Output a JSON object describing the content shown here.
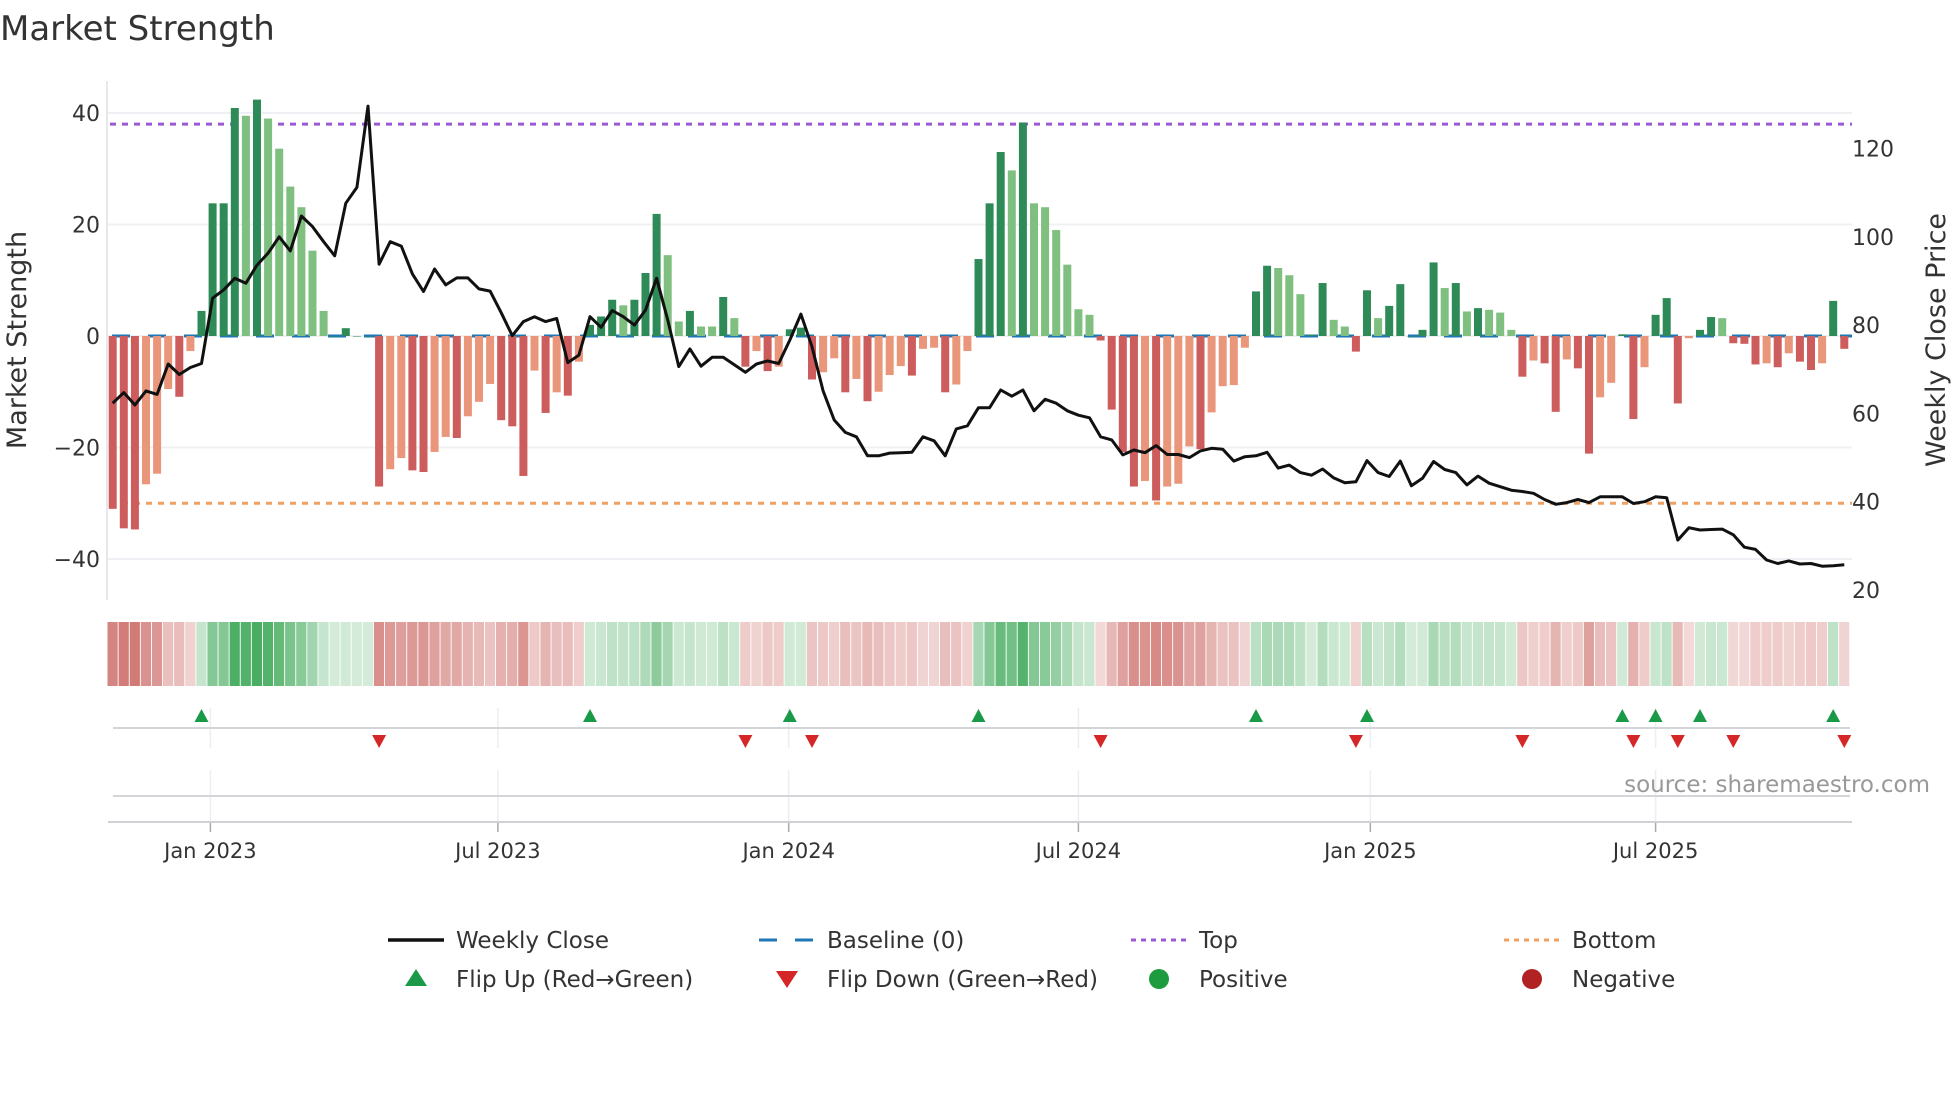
{
  "title": "Market Strength",
  "source": "source: sharemaestro.com",
  "colors": {
    "strong_pos": "#2e8b57",
    "weak_pos": "#7fbf7f",
    "strong_neg": "#cd5c5c",
    "weak_neg": "#e9967a",
    "strip_pos": "#3aa655",
    "strip_neg": "#c65a55",
    "line": "#111111",
    "baseline": "#1f77b4",
    "top": "#9b59d6",
    "bottom": "#f0a060",
    "flip_up": "#1a9a48",
    "flip_down": "#d62728",
    "positive": "#1e9b3e",
    "negative": "#b22222"
  },
  "chart_data": {
    "type": "bar",
    "title": "Market Strength",
    "ylabel": "Market Strength",
    "y2label": "Weekly Close Price",
    "ylim": [
      -45,
      45
    ],
    "y2lim": [
      20,
      129
    ],
    "yticks": [
      40,
      20,
      0,
      -20,
      -40
    ],
    "y2ticks": [
      120,
      100,
      80,
      60,
      40,
      20
    ],
    "top_level": 38,
    "bottom_level": -30,
    "baseline": 0,
    "xticks": [
      {
        "label": "Jan 2023",
        "week": 8.8
      },
      {
        "label": "Jul 2023",
        "week": 34.7
      },
      {
        "label": "Jan 2024",
        "week": 60.9
      },
      {
        "label": "Jul 2024",
        "week": 87.0
      },
      {
        "label": "Jan 2025",
        "week": 113.3
      },
      {
        "label": "Jul 2025",
        "week": 139.0
      }
    ],
    "strength": [
      -31,
      -34.5,
      -34.7,
      -26.6,
      -24.7,
      -9.5,
      -10.9,
      -2.7,
      4.5,
      23.8,
      23.8,
      40.9,
      39.5,
      42.4,
      39,
      33.6,
      26.8,
      23.1,
      15.3,
      4.5,
      0,
      1.4,
      0,
      0,
      -27,
      -23.9,
      -21.9,
      -24.1,
      -24.4,
      -20.8,
      -18.1,
      -18.3,
      -14.4,
      -11.8,
      -8.6,
      -15.1,
      -16.2,
      -25.1,
      -6.2,
      -13.8,
      -10.1,
      -10.7,
      -4.6,
      2,
      3.5,
      6.5,
      5.5,
      6.5,
      11.3,
      21.9,
      14.5,
      2.6,
      4.5,
      1.7,
      1.7,
      7,
      3.2,
      -5.5,
      -2.7,
      -6.3,
      -5.5,
      1.2,
      1.5,
      -7.8,
      -6.5,
      -4,
      -10.1,
      -7.7,
      -11.7,
      -10,
      -7,
      -5.4,
      -7.1,
      -2.3,
      -2.1,
      -10.1,
      -8.7,
      -2.7,
      13.8,
      23.8,
      33,
      29.7,
      38.3,
      23.8,
      23.1,
      19,
      12.8,
      4.8,
      3.8,
      -0.8,
      -13.2,
      -20.8,
      -27,
      -26,
      -29.5,
      -27,
      -26.5,
      -19.8,
      -20.3,
      -13.7,
      -9,
      -8.8,
      -2.1,
      8,
      12.6,
      12.2,
      10.9,
      7.5,
      0.2,
      9.5,
      2.9,
      1.7,
      -2.8,
      8.2,
      3.2,
      5.4,
      9.3,
      0,
      1.1,
      13.2,
      8.6,
      9.5,
      4.4,
      5,
      4.7,
      4.2,
      1.1,
      -7.3,
      -4.4,
      -4.9,
      -13.6,
      -4.2,
      -5.8,
      -21.1,
      -11,
      -8.4,
      0.3,
      -14.9,
      -5.6,
      3.8,
      6.8,
      -12.1,
      -0.4,
      1.1,
      3.4,
      3.2,
      -1.3,
      -1.4,
      -5.1,
      -4.9,
      -5.6,
      -3.1,
      -4.6,
      -6.1,
      -4.9,
      6.3,
      -2.3
    ],
    "strong": [
      1,
      1,
      1,
      0,
      0,
      0,
      1,
      0,
      1,
      1,
      1,
      1,
      0,
      1,
      0,
      0,
      0,
      0,
      0,
      0,
      1,
      1,
      1,
      1,
      1,
      0,
      0,
      1,
      1,
      0,
      0,
      1,
      0,
      0,
      0,
      1,
      1,
      1,
      0,
      1,
      0,
      1,
      0,
      1,
      1,
      1,
      0,
      1,
      1,
      1,
      0,
      0,
      1,
      0,
      0,
      1,
      0,
      1,
      0,
      1,
      0,
      1,
      1,
      1,
      0,
      0,
      1,
      0,
      1,
      0,
      0,
      0,
      1,
      0,
      0,
      1,
      0,
      0,
      1,
      1,
      1,
      0,
      1,
      0,
      0,
      0,
      0,
      0,
      0,
      1,
      1,
      1,
      1,
      0,
      1,
      0,
      0,
      0,
      1,
      0,
      0,
      0,
      0,
      1,
      1,
      0,
      0,
      0,
      1,
      1,
      0,
      0,
      1,
      1,
      0,
      1,
      1,
      1,
      1,
      1,
      0,
      1,
      0,
      1,
      0,
      0,
      0,
      1,
      0,
      1,
      1,
      0,
      1,
      1,
      0,
      0,
      1,
      1,
      0,
      1,
      1,
      1,
      0,
      1,
      1,
      0,
      1,
      1,
      1,
      0,
      1,
      0,
      1,
      1,
      0,
      1,
      1
    ],
    "weekly_close": [
      62.3,
      64.7,
      61.9,
      65.1,
      64.3,
      71.2,
      68.8,
      70.4,
      71.3,
      86.1,
      88,
      90.6,
      89.5,
      93.6,
      96.3,
      100,
      96.8,
      104.7,
      102.3,
      98.9,
      95.7,
      107.6,
      111.2,
      129.6,
      93.8,
      98.9,
      97.9,
      91.6,
      87.6,
      92.7,
      89.1,
      90.7,
      90.7,
      88.2,
      87.7,
      82.8,
      77.6,
      80.8,
      81.9,
      80.8,
      81.5,
      71.5,
      73.2,
      81.9,
      79.5,
      83.3,
      81.9,
      80,
      83.4,
      90.6,
      81.2,
      70.6,
      74.6,
      70.7,
      72.7,
      72.7,
      71,
      69.3,
      71.2,
      71.9,
      71.3,
      76.6,
      82.5,
      75.1,
      65.1,
      58.5,
      55.7,
      54.7,
      50.4,
      50.4,
      51,
      51.1,
      51.2,
      54.7,
      53.8,
      50.4,
      56.5,
      57.2,
      61.3,
      61.3,
      65.3,
      63.9,
      65.3,
      60.6,
      63.2,
      62.3,
      60.6,
      59.6,
      59,
      54.7,
      54,
      50.6,
      51.7,
      51.1,
      52.7,
      50.7,
      50.7,
      50,
      51.5,
      52.1,
      51.9,
      49.2,
      50.2,
      50.4,
      51.2,
      47.6,
      48.3,
      46.6,
      46,
      47.4,
      45.4,
      44.3,
      44.5,
      49.3,
      46.6,
      45.7,
      49.2,
      43.6,
      45.3,
      49.1,
      47.3,
      46.6,
      43.8,
      45.8,
      44.2,
      43.4,
      42.6,
      42.3,
      41.9,
      40.5,
      39.4,
      39.8,
      40.5,
      39.8,
      41.1,
      41.1,
      41.1,
      39.6,
      40,
      41.1,
      40.9,
      31.3,
      34.1,
      33.6,
      33.7,
      33.8,
      32.5,
      29.7,
      29.2,
      26.8,
      26,
      26.6,
      25.9,
      26,
      25.4,
      25.5,
      25.7
    ],
    "flip_up_weeks": [
      8,
      43,
      61,
      78,
      103,
      113,
      136,
      139,
      143,
      155
    ],
    "flip_down_weeks": [
      24,
      57,
      63,
      89,
      112,
      127,
      137,
      141,
      146,
      156
    ],
    "legend": [
      {
        "key": "close",
        "label": "Weekly Close"
      },
      {
        "key": "baseline",
        "label": "Baseline (0)"
      },
      {
        "key": "top",
        "label": "Top"
      },
      {
        "key": "bottom",
        "label": "Bottom"
      },
      {
        "key": "flip_up",
        "label": "Flip Up (Red→Green)"
      },
      {
        "key": "flip_down",
        "label": "Flip Down (Green→Red)"
      },
      {
        "key": "positive",
        "label": "Positive"
      },
      {
        "key": "negative",
        "label": "Negative"
      }
    ],
    "legend_position": "bottom"
  }
}
